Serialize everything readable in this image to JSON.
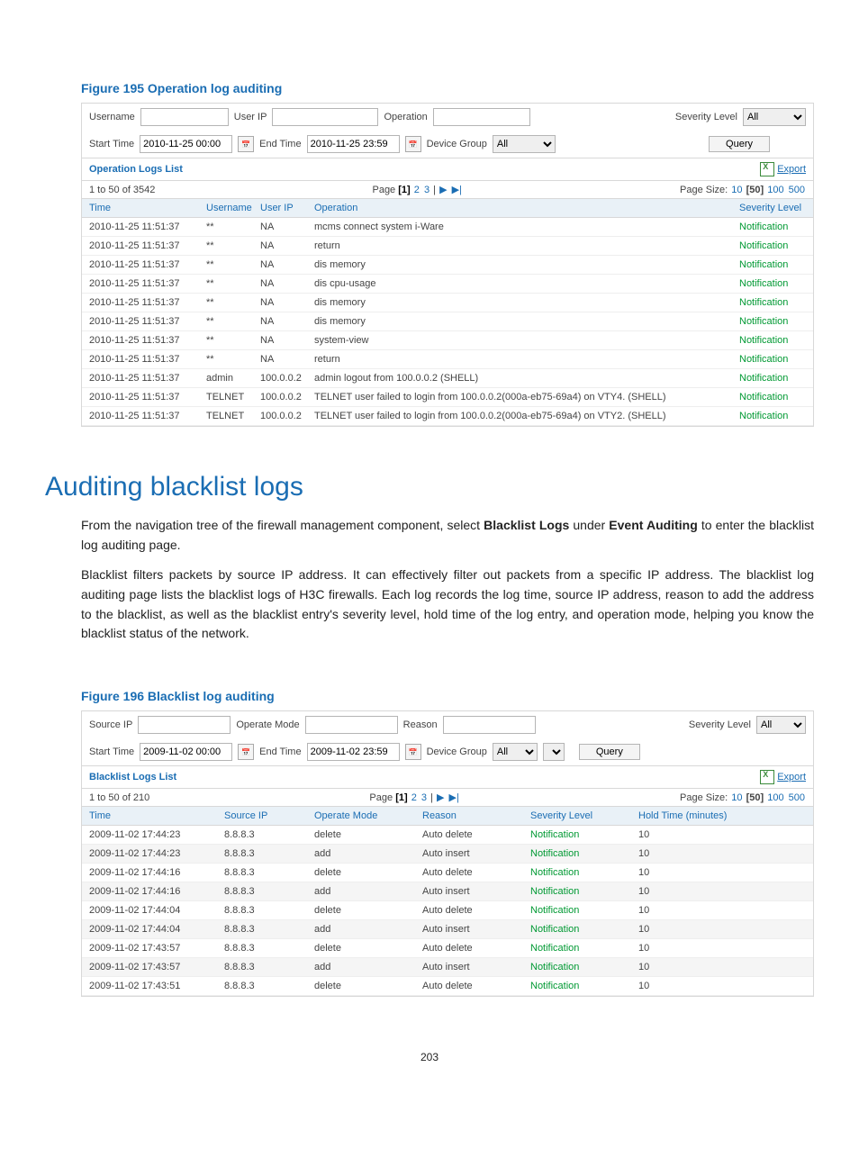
{
  "figure195": {
    "title": "Figure 195 Operation log auditing",
    "filter": {
      "username_label": "Username",
      "userip_label": "User IP",
      "operation_label": "Operation",
      "severity_label": "Severity Level",
      "severity_value": "All",
      "start_label": "Start Time",
      "start_value": "2010-11-25 00:00",
      "end_label": "End Time",
      "end_value": "2010-11-25 23:59",
      "device_group_label": "Device Group",
      "device_group_value": "All",
      "query": "Query"
    },
    "list_title": "Operation Logs List",
    "export": "Export",
    "count_text": "1 to 50 of 3542",
    "page_prefix": "Page",
    "page_size_label": "Page Size:",
    "page_sizes": [
      "10",
      "[50]",
      "100",
      "500"
    ],
    "columns": [
      "Time",
      "Username",
      "User IP",
      "Operation",
      "Severity Level"
    ],
    "rows": [
      {
        "time": "2010-11-25 11:51:37",
        "user": "**",
        "ip": "NA",
        "op": "mcms connect system i-Ware",
        "sev": "Notification"
      },
      {
        "time": "2010-11-25 11:51:37",
        "user": "**",
        "ip": "NA",
        "op": "return",
        "sev": "Notification"
      },
      {
        "time": "2010-11-25 11:51:37",
        "user": "**",
        "ip": "NA",
        "op": "dis memory",
        "sev": "Notification"
      },
      {
        "time": "2010-11-25 11:51:37",
        "user": "**",
        "ip": "NA",
        "op": "dis cpu-usage",
        "sev": "Notification"
      },
      {
        "time": "2010-11-25 11:51:37",
        "user": "**",
        "ip": "NA",
        "op": "dis memory",
        "sev": "Notification"
      },
      {
        "time": "2010-11-25 11:51:37",
        "user": "**",
        "ip": "NA",
        "op": "dis memory",
        "sev": "Notification"
      },
      {
        "time": "2010-11-25 11:51:37",
        "user": "**",
        "ip": "NA",
        "op": "system-view",
        "sev": "Notification"
      },
      {
        "time": "2010-11-25 11:51:37",
        "user": "**",
        "ip": "NA",
        "op": "return",
        "sev": "Notification"
      },
      {
        "time": "2010-11-25 11:51:37",
        "user": "admin",
        "ip": "100.0.0.2",
        "op": "admin logout from 100.0.0.2 (SHELL)",
        "sev": "Notification"
      },
      {
        "time": "2010-11-25 11:51:37",
        "user": "TELNET",
        "ip": "100.0.0.2",
        "op": "TELNET user failed to login from 100.0.0.2(000a-eb75-69a4) on VTY4. (SHELL)",
        "sev": "Notification"
      },
      {
        "time": "2010-11-25 11:51:37",
        "user": "TELNET",
        "ip": "100.0.0.2",
        "op": "TELNET user failed to login from 100.0.0.2(000a-eb75-69a4) on VTY2. (SHELL)",
        "sev": "Notification"
      }
    ]
  },
  "section": {
    "heading": "Auditing blacklist logs",
    "p1_a": "From the navigation tree of the firewall management component, select ",
    "p1_b": "Blacklist Logs",
    "p1_c": " under ",
    "p1_d": "Event Auditing",
    "p1_e": " to enter the blacklist log auditing page.",
    "p2": "Blacklist filters packets by source IP address. It can effectively filter out packets from a specific IP address. The blacklist log auditing page lists the blacklist logs of H3C firewalls. Each log records the log time, source IP address, reason to add the address to the blacklist, as well as the blacklist entry's severity level, hold time of the log entry, and operation mode, helping you know the blacklist status of the network."
  },
  "figure196": {
    "title": "Figure 196 Blacklist log auditing",
    "filter": {
      "sourceip_label": "Source IP",
      "operatemode_label": "Operate Mode",
      "reason_label": "Reason",
      "severity_label": "Severity Level",
      "severity_value": "All",
      "start_label": "Start Time",
      "start_value": "2009-11-02 00:00",
      "end_label": "End Time",
      "end_value": "2009-11-02 23:59",
      "device_group_label": "Device Group",
      "device_group_value": "All",
      "query": "Query"
    },
    "list_title": "Blacklist Logs List",
    "export": "Export",
    "count_text": "1 to 50 of 210",
    "page_prefix": "Page",
    "page_size_label": "Page Size:",
    "page_sizes": [
      "10",
      "[50]",
      "100",
      "500"
    ],
    "columns": [
      "Time",
      "Source IP",
      "Operate Mode",
      "Reason",
      "Severity Level",
      "Hold Time (minutes)"
    ],
    "rows": [
      {
        "time": "2009-11-02 17:44:23",
        "ip": "8.8.8.3",
        "mode": "delete",
        "reason": "Auto delete",
        "sev": "Notification",
        "hold": "10"
      },
      {
        "time": "2009-11-02 17:44:23",
        "ip": "8.8.8.3",
        "mode": "add",
        "reason": "Auto insert",
        "sev": "Notification",
        "hold": "10"
      },
      {
        "time": "2009-11-02 17:44:16",
        "ip": "8.8.8.3",
        "mode": "delete",
        "reason": "Auto delete",
        "sev": "Notification",
        "hold": "10"
      },
      {
        "time": "2009-11-02 17:44:16",
        "ip": "8.8.8.3",
        "mode": "add",
        "reason": "Auto insert",
        "sev": "Notification",
        "hold": "10"
      },
      {
        "time": "2009-11-02 17:44:04",
        "ip": "8.8.8.3",
        "mode": "delete",
        "reason": "Auto delete",
        "sev": "Notification",
        "hold": "10"
      },
      {
        "time": "2009-11-02 17:44:04",
        "ip": "8.8.8.3",
        "mode": "add",
        "reason": "Auto insert",
        "sev": "Notification",
        "hold": "10"
      },
      {
        "time": "2009-11-02 17:43:57",
        "ip": "8.8.8.3",
        "mode": "delete",
        "reason": "Auto delete",
        "sev": "Notification",
        "hold": "10"
      },
      {
        "time": "2009-11-02 17:43:57",
        "ip": "8.8.8.3",
        "mode": "add",
        "reason": "Auto insert",
        "sev": "Notification",
        "hold": "10"
      },
      {
        "time": "2009-11-02 17:43:51",
        "ip": "8.8.8.3",
        "mode": "delete",
        "reason": "Auto delete",
        "sev": "Notification",
        "hold": "10"
      }
    ]
  },
  "page_number": "203"
}
